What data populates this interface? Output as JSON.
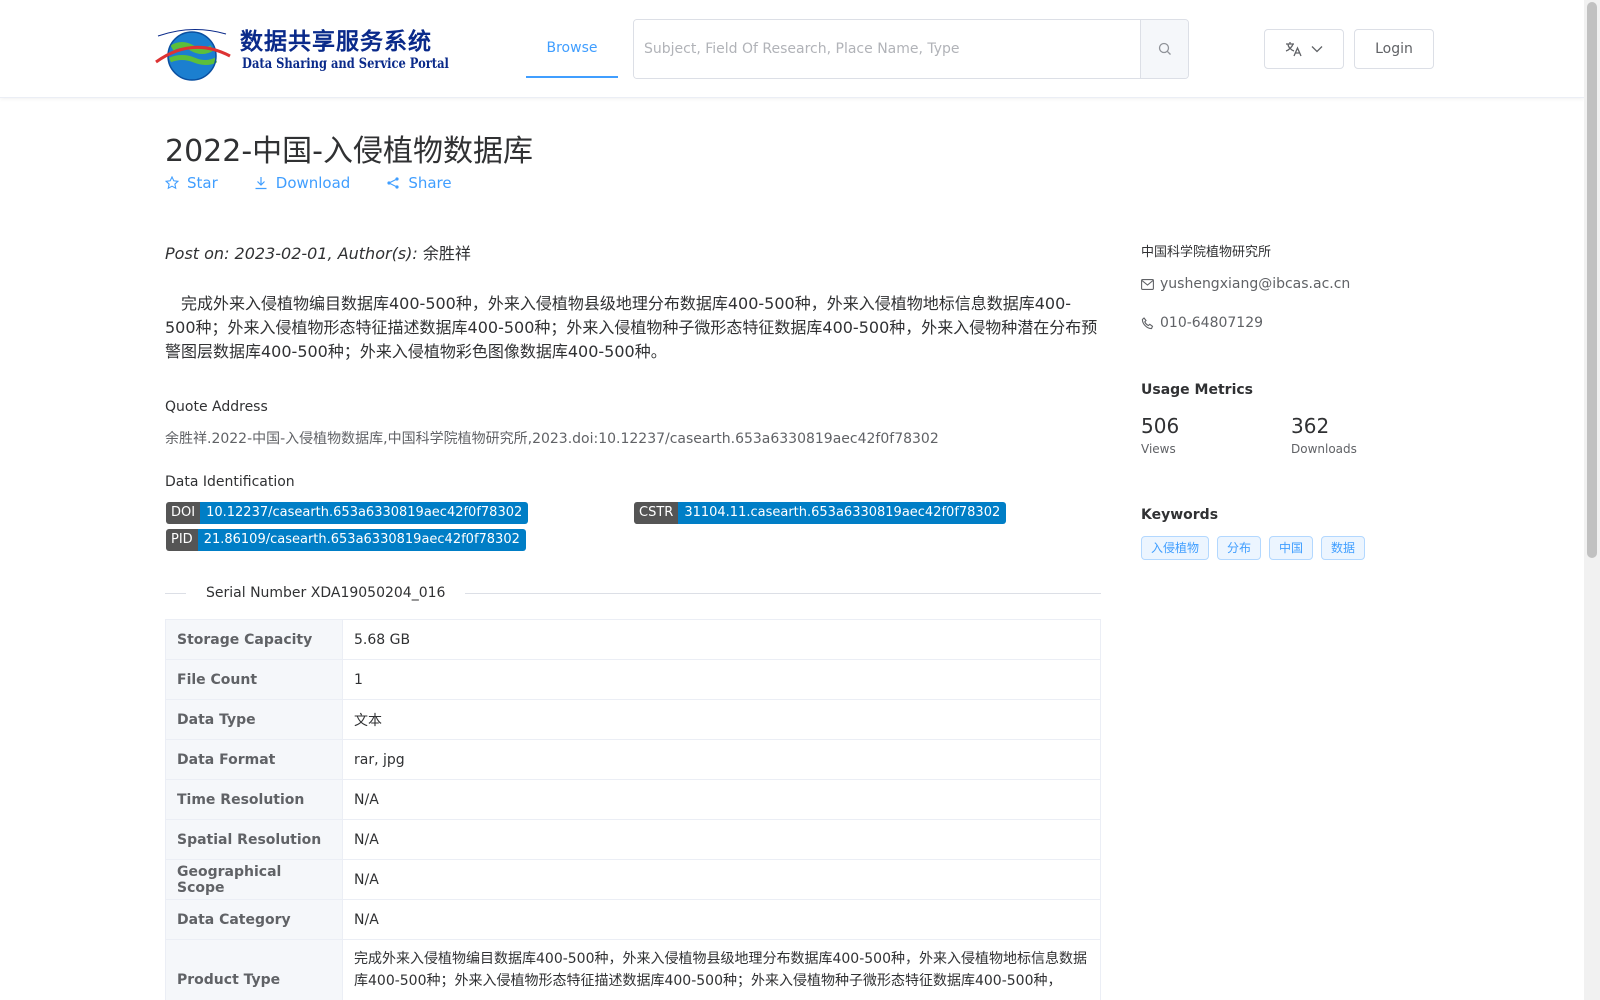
{
  "header": {
    "logo_cn": "数据共享服务系统",
    "logo_en": "Data Sharing and Service Portal",
    "nav_browse": "Browse",
    "search_placeholder": "Subject, Field Of Research, Place Name, Type",
    "login_label": "Login"
  },
  "dataset": {
    "title": "2022-中国-入侵植物数据库",
    "actions": {
      "star": "Star",
      "download": "Download",
      "share": "Share"
    },
    "post_on_label": "Post on: 2023-02-01, Author(s):",
    "authors": "余胜祥",
    "description": "完成外来入侵植物编目数据库400-500种，外来入侵植物县级地理分布数据库400-500种，外来入侵植物地标信息数据库400-500种；外来入侵植物形态特征描述数据库400-500种；外来入侵植物种子微形态特征数据库400-500种，外来入侵物种潜在分布预警图层数据库400-500种；外来入侵植物彩色图像数据库400-500种。",
    "quote_label": "Quote Address",
    "quote_text": "余胜祥.2022-中国-入侵植物数据库,中国科学院植物研究所,2023.doi:10.12237/casearth.653a6330819aec42f0f78302",
    "ident_label": "Data Identification",
    "doi_key": "DOI",
    "doi_val": "10.12237/casearth.653a6330819aec42f0f78302",
    "cstr_key": "CSTR",
    "cstr_val": "31104.11.casearth.653a6330819aec42f0f78302",
    "pid_key": "PID",
    "pid_val": "21.86109/casearth.653a6330819aec42f0f78302",
    "serial": "Serial Number XDA19050204_016"
  },
  "metadata_rows": [
    {
      "label": "Storage Capacity",
      "value": "5.68 GB"
    },
    {
      "label": "File Count",
      "value": "1"
    },
    {
      "label": "Data Type",
      "value": "文本"
    },
    {
      "label": "Data Format",
      "value": "rar, jpg"
    },
    {
      "label": "Time Resolution",
      "value": "N/A"
    },
    {
      "label": "Spatial Resolution",
      "value": "N/A"
    },
    {
      "label": "Geographical Scope",
      "value": "N/A"
    },
    {
      "label": "Data Category",
      "value": "N/A"
    },
    {
      "label": "Product Type",
      "value": "完成外来入侵植物编目数据库400-500种，外来入侵植物县级地理分布数据库400-500种，外来入侵植物地标信息数据库400-500种；外来入侵植物形态特征描述数据库400-500种；外来入侵植物种子微形态特征数据库400-500种，"
    }
  ],
  "sidebar": {
    "organization": "中国科学院植物研究所",
    "email": "yushengxiang@ibcas.ac.cn",
    "phone": "010-64807129",
    "metrics_title": "Usage Metrics",
    "views_num": "506",
    "views_label": "Views",
    "downloads_num": "362",
    "downloads_label": "Downloads",
    "keywords_title": "Keywords",
    "keywords": [
      "入侵植物",
      "分布",
      "中国",
      "数据"
    ]
  },
  "colors": {
    "accent": "#409eff",
    "badge_key": "#555555",
    "badge_value": "#007ec6"
  },
  "icons": {
    "star": "star-icon",
    "download": "download-icon",
    "share": "share-icon",
    "search": "search-icon",
    "translate": "translate-icon",
    "mail": "mail-icon",
    "phone": "phone-icon"
  }
}
